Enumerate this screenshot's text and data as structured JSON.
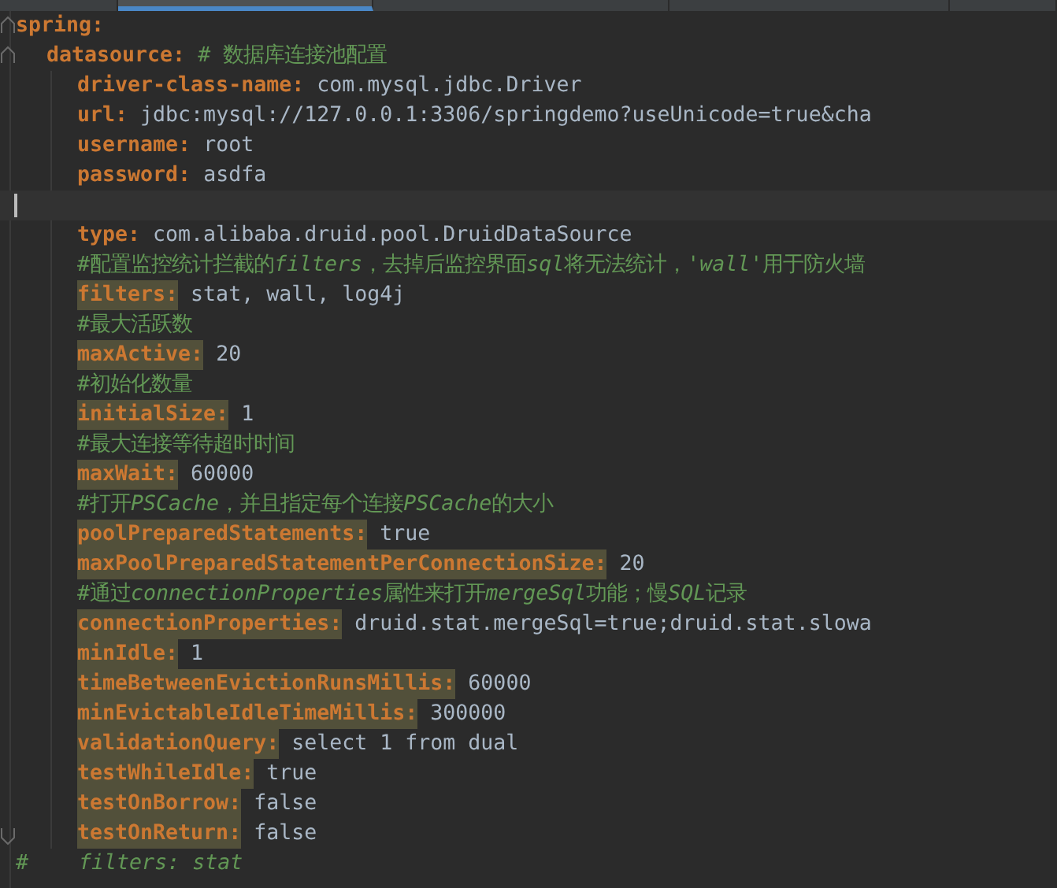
{
  "tabs": [
    {
      "selected": false
    },
    {
      "selected": true
    },
    {
      "selected": false
    },
    {
      "selected": false
    },
    {
      "selected": false
    }
  ],
  "lines": [
    {
      "kind": "pair",
      "key": "spring:",
      "children": [
        {
          "kind": "pair",
          "key": "datasource:",
          "comment": "# 数据库连接池配置",
          "children": [
            {
              "kind": "pair",
              "key": "driver-class-name:",
              "value": "com.mysql.jdbc.Driver",
              "highlighted": false
            },
            {
              "kind": "pair",
              "key": "url:",
              "value": "jdbc:mysql://127.0.0.1:3306/springdemo?useUnicode=true&cha",
              "highlighted": false
            },
            {
              "kind": "pair",
              "key": "username:",
              "value": "root",
              "highlighted": false
            },
            {
              "kind": "pair",
              "key": "password:",
              "value": "asdfa",
              "highlighted": false
            },
            {
              "kind": "blank",
              "caret": true
            },
            {
              "kind": "pair",
              "key": "type:",
              "value": "com.alibaba.druid.pool.DruidDataSource",
              "highlighted": false
            },
            {
              "kind": "comment",
              "parts": [
                {
                  "text": "#配置监控统计拦截的",
                  "italic": false
                },
                {
                  "text": "filters",
                  "italic": true
                },
                {
                  "text": "，去掉后监控界面",
                  "italic": false
                },
                {
                  "text": "sql",
                  "italic": true
                },
                {
                  "text": "将无法统计，",
                  "italic": false
                },
                {
                  "text": "'wall'",
                  "italic": true
                },
                {
                  "text": "用于防火墙",
                  "italic": false
                }
              ]
            },
            {
              "kind": "pair",
              "key": "filters:",
              "value": "stat, wall, log4j",
              "highlighted": true
            },
            {
              "kind": "comment",
              "parts": [
                {
                  "text": "#最大活跃数",
                  "italic": false
                }
              ]
            },
            {
              "kind": "pair",
              "key": "maxActive:",
              "value": "20",
              "highlighted": true
            },
            {
              "kind": "comment",
              "parts": [
                {
                  "text": "#初始化数量",
                  "italic": false
                }
              ]
            },
            {
              "kind": "pair",
              "key": "initialSize:",
              "value": "1",
              "highlighted": true
            },
            {
              "kind": "comment",
              "parts": [
                {
                  "text": "#最大连接等待超时时间",
                  "italic": false
                }
              ]
            },
            {
              "kind": "pair",
              "key": "maxWait:",
              "value": "60000",
              "highlighted": true
            },
            {
              "kind": "comment",
              "parts": [
                {
                  "text": "#打开",
                  "italic": false
                },
                {
                  "text": "PSCache",
                  "italic": true
                },
                {
                  "text": "，并且指定每个连接",
                  "italic": false
                },
                {
                  "text": "PSCache",
                  "italic": true
                },
                {
                  "text": "的大小",
                  "italic": false
                }
              ]
            },
            {
              "kind": "pair",
              "key": "poolPreparedStatements:",
              "value": "true",
              "highlighted": true
            },
            {
              "kind": "pair",
              "key": "maxPoolPreparedStatementPerConnectionSize:",
              "value": "20",
              "highlighted": true
            },
            {
              "kind": "comment",
              "parts": [
                {
                  "text": "#通过",
                  "italic": false
                },
                {
                  "text": "connectionProperties",
                  "italic": true
                },
                {
                  "text": "属性来打开",
                  "italic": false
                },
                {
                  "text": "mergeSql",
                  "italic": true
                },
                {
                  "text": "功能；慢",
                  "italic": false
                },
                {
                  "text": "SQL",
                  "italic": true
                },
                {
                  "text": "记录",
                  "italic": false
                }
              ]
            },
            {
              "kind": "pair",
              "key": "connectionProperties:",
              "value": "druid.stat.mergeSql=true;druid.stat.slowa",
              "highlighted": true
            },
            {
              "kind": "pair",
              "key": "minIdle:",
              "value": "1",
              "highlighted": true
            },
            {
              "kind": "pair",
              "key": "timeBetweenEvictionRunsMillis:",
              "value": "60000",
              "highlighted": true
            },
            {
              "kind": "pair",
              "key": "minEvictableIdleTimeMillis:",
              "value": "300000",
              "highlighted": true
            },
            {
              "kind": "pair",
              "key": "validationQuery:",
              "value": "select 1 from dual",
              "highlighted": true
            },
            {
              "kind": "pair",
              "key": "testWhileIdle:",
              "value": "true",
              "highlighted": true
            },
            {
              "kind": "pair",
              "key": "testOnBorrow:",
              "value": "false",
              "highlighted": true
            },
            {
              "kind": "pair",
              "key": "testOnReturn:",
              "value": "false",
              "highlighted": true
            }
          ]
        }
      ]
    },
    {
      "kind": "comment",
      "parts": [
        {
          "text": "#    ",
          "italic": false
        },
        {
          "text": "filters: stat",
          "italic": true
        }
      ]
    }
  ]
}
